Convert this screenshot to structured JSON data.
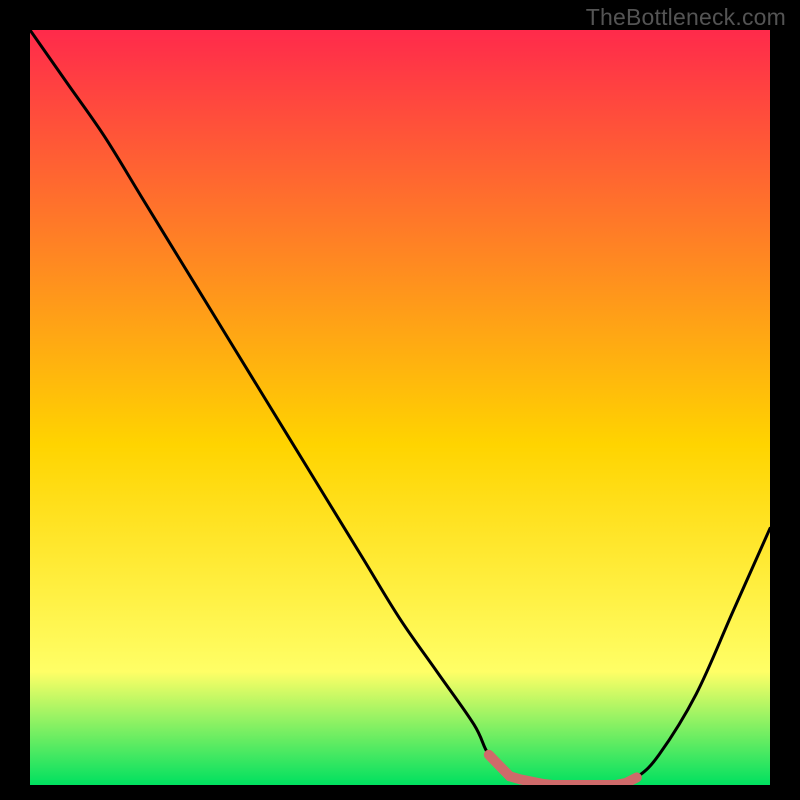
{
  "attribution": "TheBottleneck.com",
  "colors": {
    "background": "#000000",
    "gradient_top": "#ff2a4b",
    "gradient_mid": "#ffd400",
    "gradient_low": "#ffff66",
    "gradient_bottom": "#00e060",
    "curve": "#000000",
    "marker_range": "#cf6a6a"
  },
  "chart_data": {
    "type": "line",
    "title": "",
    "xlabel": "",
    "ylabel": "",
    "xlim": [
      0,
      100
    ],
    "ylim": [
      0,
      100
    ],
    "categories": [
      0,
      5,
      10,
      15,
      20,
      25,
      30,
      35,
      40,
      45,
      50,
      55,
      60,
      62,
      65,
      70,
      75,
      80,
      82,
      85,
      90,
      95,
      100
    ],
    "values": [
      100,
      93,
      86,
      78,
      70,
      62,
      54,
      46,
      38,
      30,
      22,
      15,
      8,
      4,
      1,
      0,
      0,
      0,
      1,
      4,
      12,
      23,
      34
    ],
    "optimal_range": {
      "start_x": 62,
      "end_x": 82
    },
    "annotations": []
  }
}
